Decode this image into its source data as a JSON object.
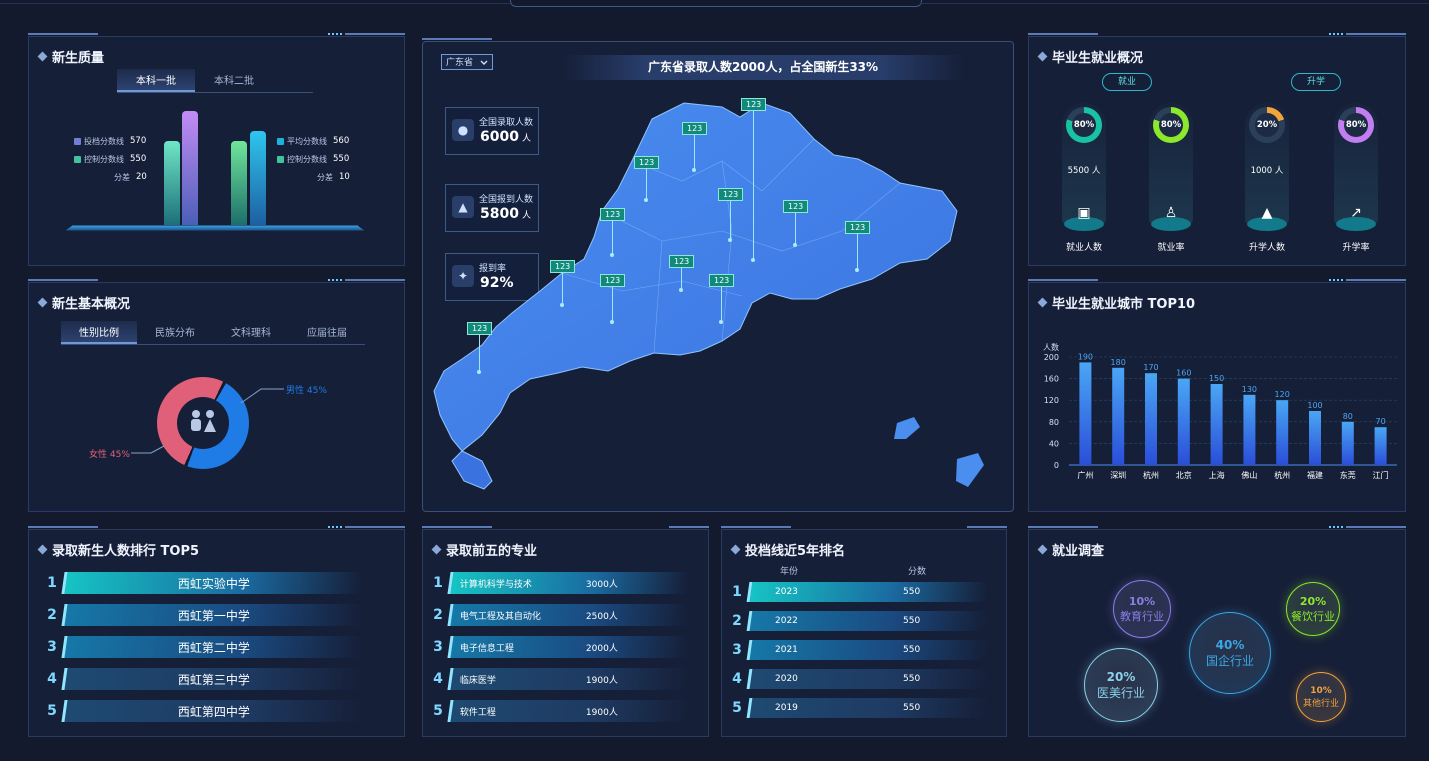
{
  "quality": {
    "title": "新生质量",
    "tabs": [
      "本科一批",
      "本科二批"
    ],
    "left_legend": [
      {
        "label": "投档分数线",
        "value": "570",
        "color": "#6f7fd8"
      },
      {
        "label": "控制分数线",
        "value": "550",
        "color": "#41c49b"
      },
      {
        "label": "分差",
        "value": "20",
        "color": ""
      }
    ],
    "right_legend": [
      {
        "label": "平均分数线",
        "value": "560",
        "color": "#1fb0e0"
      },
      {
        "label": "控制分数线",
        "value": "550",
        "color": "#41c49b"
      },
      {
        "label": "分差",
        "value": "10",
        "color": ""
      }
    ]
  },
  "basic": {
    "title": "新生基本概况",
    "tabs": [
      "性别比例",
      "民族分布",
      "文科理科",
      "应届往届"
    ],
    "male_label": "男性 45%",
    "female_label": "女性 45%",
    "male_color": "#1f7be6",
    "female_color": "#e0607a"
  },
  "map": {
    "province_select": "广东省",
    "headline": "广东省录取人数2000人，占全国新生33%",
    "stats": [
      {
        "label": "全国录取人数",
        "value": "6000",
        "unit": "人",
        "icon": "group-icon"
      },
      {
        "label": "全国报到人数",
        "value": "5800",
        "unit": "人",
        "icon": "checkin-icon"
      },
      {
        "label": "报到率",
        "value": "92%",
        "unit": "",
        "icon": "rate-icon"
      }
    ],
    "tag_value": "123"
  },
  "employment": {
    "title": "毕业生就业概况",
    "buttons": [
      "就业",
      "升学"
    ],
    "cards": [
      {
        "percent": "80%",
        "sub": "5500 人",
        "label": "就业人数",
        "color": "#17c3a2",
        "pct": 0.8
      },
      {
        "percent": "80%",
        "sub": "",
        "label": "就业率",
        "color": "#8be82a",
        "pct": 0.8
      },
      {
        "percent": "20%",
        "sub": "1000 人",
        "label": "升学人数",
        "color": "#f2a33a",
        "pct": 0.2
      },
      {
        "percent": "80%",
        "sub": "",
        "label": "升学率",
        "color": "#c27ef0",
        "pct": 0.8
      }
    ]
  },
  "cities": {
    "title": "毕业生就业城市 TOP10",
    "chart_data": {
      "type": "bar",
      "ylabel": "人数",
      "categories": [
        "广州",
        "深圳",
        "杭州",
        "北京",
        "上海",
        "佛山",
        "杭州",
        "福建",
        "东莞",
        "江门"
      ],
      "values": [
        190,
        180,
        170,
        160,
        150,
        130,
        120,
        100,
        80,
        70
      ],
      "yticks": [
        "200",
        "160",
        "120",
        "80",
        "40",
        "0"
      ],
      "ylim": [
        0,
        200
      ]
    }
  },
  "top5": {
    "title": "录取新生人数排行 TOP5",
    "rows": [
      {
        "rank": "1",
        "name": "西虹实验中学"
      },
      {
        "rank": "2",
        "name": "西虹第一中学"
      },
      {
        "rank": "3",
        "name": "西虹第二中学"
      },
      {
        "rank": "4",
        "name": "西虹第三中学"
      },
      {
        "rank": "5",
        "name": "西虹第四中学"
      }
    ]
  },
  "majors": {
    "title": "录取前五的专业",
    "rows": [
      {
        "rank": "1",
        "name": "计算机科学与技术",
        "count": "3000人"
      },
      {
        "rank": "2",
        "name": "电气工程及其自动化",
        "count": "2500人"
      },
      {
        "rank": "3",
        "name": "电子信息工程",
        "count": "2000人"
      },
      {
        "rank": "4",
        "name": "临床医学",
        "count": "1900人"
      },
      {
        "rank": "5",
        "name": "软件工程",
        "count": "1900人"
      }
    ]
  },
  "scoreline": {
    "title": "投档线近5年排名",
    "col_year": "年份",
    "col_score": "分数",
    "rows": [
      {
        "rank": "1",
        "year": "2023",
        "score": "550"
      },
      {
        "rank": "2",
        "year": "2022",
        "score": "550"
      },
      {
        "rank": "3",
        "year": "2021",
        "score": "550"
      },
      {
        "rank": "4",
        "year": "2020",
        "score": "550"
      },
      {
        "rank": "5",
        "year": "2019",
        "score": "550"
      }
    ]
  },
  "survey": {
    "title": "就业调查",
    "bubbles": [
      {
        "pct": "10%",
        "label": "教育行业",
        "color": "#8a7ee8"
      },
      {
        "pct": "40%",
        "label": "国企行业",
        "color": "#3aa6e6"
      },
      {
        "pct": "20%",
        "label": "餐饮行业",
        "color": "#8be82a"
      },
      {
        "pct": "20%",
        "label": "医美行业",
        "color": "#8ad0ea"
      },
      {
        "pct": "10%",
        "label": "其他行业",
        "color": "#f2a33a"
      }
    ]
  }
}
